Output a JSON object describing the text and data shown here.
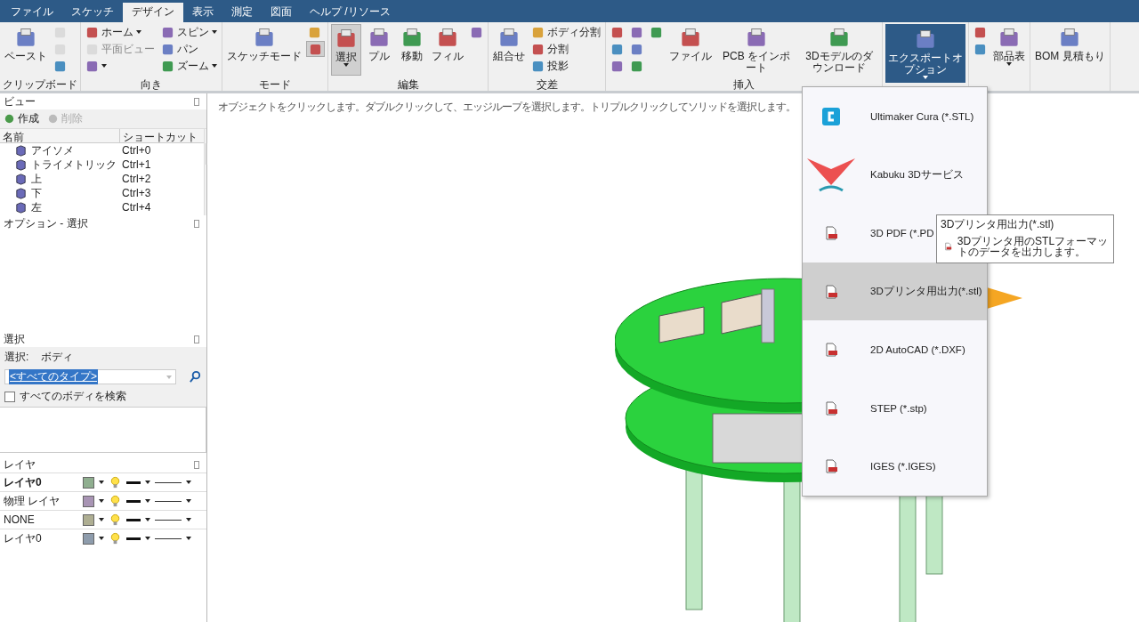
{
  "menu_tabs": [
    {
      "label": "ファイル",
      "selected": false
    },
    {
      "label": "スケッチ",
      "selected": false
    },
    {
      "label": "デザイン",
      "selected": true
    },
    {
      "label": "表示",
      "selected": false
    },
    {
      "label": "測定",
      "selected": false
    },
    {
      "label": "図面",
      "selected": false
    },
    {
      "label": "ヘルプ /リソース",
      "selected": false
    }
  ],
  "ribbon": [
    {
      "label": "クリップボード",
      "columns": [
        [
          {
            "kind": "large",
            "label": "ペースト"
          }
        ],
        [
          {
            "kind": "small",
            "disabled": true
          },
          {
            "kind": "small",
            "disabled": true
          },
          {
            "kind": "small",
            "disabled": false
          }
        ]
      ]
    },
    {
      "label": "向き",
      "columns": [
        [
          {
            "kind": "small",
            "label": "ホーム",
            "dropdown": true,
            "disabled": false
          },
          {
            "kind": "small",
            "label": "平面ビュー",
            "disabled": true
          },
          {
            "kind": "small",
            "dropdown": true,
            "disabled": false
          }
        ],
        [
          {
            "kind": "small",
            "label": "スピン",
            "dropdown": true,
            "disabled": false
          },
          {
            "kind": "small",
            "label": "パン",
            "disabled": false
          },
          {
            "kind": "small",
            "label": "ズーム",
            "dropdown": true,
            "disabled": false
          }
        ]
      ]
    },
    {
      "label": "モード",
      "columns": [
        [
          {
            "kind": "large",
            "label": "スケッチモード"
          }
        ],
        [
          {
            "kind": "small",
            "disabled": false,
            "selected": false
          },
          {
            "kind": "small",
            "disabled": false,
            "selected": true
          }
        ]
      ]
    },
    {
      "label": "編集",
      "columns": [
        [
          {
            "kind": "large",
            "label": "選択",
            "dropdown": true,
            "selected": true
          }
        ],
        [
          {
            "kind": "large",
            "label": "プル",
            "selected": false
          }
        ],
        [
          {
            "kind": "large",
            "label": "移動",
            "selected": false
          }
        ],
        [
          {
            "kind": "large",
            "label": "フィル",
            "selected": false
          }
        ],
        [
          {
            "kind": "small",
            "disabled": false
          }
        ]
      ]
    },
    {
      "label": "交差",
      "columns": [
        [
          {
            "kind": "large",
            "label": "組合せ"
          }
        ],
        [
          {
            "kind": "small",
            "label": "ボディ分割",
            "disabled": false
          },
          {
            "kind": "small",
            "label": "分割",
            "disabled": false
          },
          {
            "kind": "small",
            "label": "投影",
            "disabled": false
          }
        ]
      ]
    },
    {
      "label": "挿入",
      "columns": [
        [
          {
            "kind": "small",
            "disabled": false
          },
          {
            "kind": "small",
            "disabled": false
          },
          {
            "kind": "small",
            "disabled": false
          }
        ],
        [
          {
            "kind": "small",
            "disabled": false
          },
          {
            "kind": "small",
            "disabled": false
          },
          {
            "kind": "small",
            "disabled": false
          }
        ],
        [
          {
            "kind": "small",
            "disabled": false
          }
        ],
        [
          {
            "kind": "large",
            "label": "ファイル"
          }
        ],
        [
          {
            "kind": "large",
            "label": "PCB をインポート"
          }
        ],
        [
          {
            "kind": "large",
            "label": "3Dモデルのダウンロード"
          }
        ]
      ]
    },
    {
      "columns": [
        [
          {
            "kind": "large",
            "label": "エクスポートオプション",
            "dropdown": true,
            "selected": true
          }
        ]
      ]
    },
    {
      "columns": [
        [
          {
            "kind": "small",
            "disabled": false
          },
          {
            "kind": "small",
            "disabled": false
          }
        ],
        [
          {
            "kind": "large",
            "label": "部品表",
            "dropdown": true
          }
        ]
      ]
    },
    {
      "columns": [
        [
          {
            "kind": "large",
            "label": "BOM 見積もり"
          }
        ]
      ]
    }
  ],
  "view_panel": {
    "title": "ビュー",
    "toolbar": [
      {
        "label": "作成",
        "disabled": false
      },
      {
        "label": "削除",
        "disabled": true
      }
    ],
    "columns": [
      "名前",
      "ショートカット"
    ],
    "rows": [
      {
        "name": "アイソメ",
        "shortcut": "Ctrl+0"
      },
      {
        "name": "トライメトリック",
        "shortcut": "Ctrl+1"
      },
      {
        "name": "上",
        "shortcut": "Ctrl+2"
      },
      {
        "name": "下",
        "shortcut": "Ctrl+3"
      },
      {
        "name": "左",
        "shortcut": "Ctrl+4"
      }
    ]
  },
  "options_panel": {
    "title": "オプション - 選択"
  },
  "selection_panel": {
    "title": "選択",
    "label": "選択:",
    "value": "ボディ",
    "type_filter": "<すべてのタイプ>",
    "search_all": {
      "label": "すべてのボディを検索",
      "checked": false
    }
  },
  "layers_panel": {
    "title": "レイヤ",
    "rows": [
      {
        "name": "レイヤ0",
        "active": true,
        "color": "#8fae8f"
      },
      {
        "name": "物理 レイヤ",
        "active": false,
        "color": "#a894b4"
      },
      {
        "name": "NONE",
        "active": false,
        "color": "#aeae92"
      },
      {
        "name": "レイヤ0",
        "active": false,
        "color": "#8e9cac"
      }
    ]
  },
  "viewport": {
    "hint": "オブジェクトをクリックします。ダブルクリックして、エッジループを選択します。トリプルクリックしてソリッドを選択します。"
  },
  "export_menu": {
    "items": [
      {
        "kind": "cura",
        "label": "Ultimaker Cura (*.STL)",
        "selected": false
      },
      {
        "kind": "kabuku",
        "label": "Kabuku 3Dサービス",
        "selected": false
      },
      {
        "kind": "pdf",
        "label": "3D PDF (*.PD",
        "selected": false
      },
      {
        "kind": "stl",
        "label": "3Dプリンタ用出力(*.stl)",
        "selected": true
      },
      {
        "kind": "file",
        "label": "2D AutoCAD (*.DXF)",
        "selected": false
      },
      {
        "kind": "file",
        "label": "STEP (*.stp)",
        "selected": false
      },
      {
        "kind": "file",
        "label": "IGES (*.IGES)",
        "selected": false
      }
    ],
    "tooltip": {
      "title": "3Dプリンタ用出力(*.stl)",
      "description": "3Dプリンタ用のSTLフォーマットのデータを出力します。"
    }
  }
}
